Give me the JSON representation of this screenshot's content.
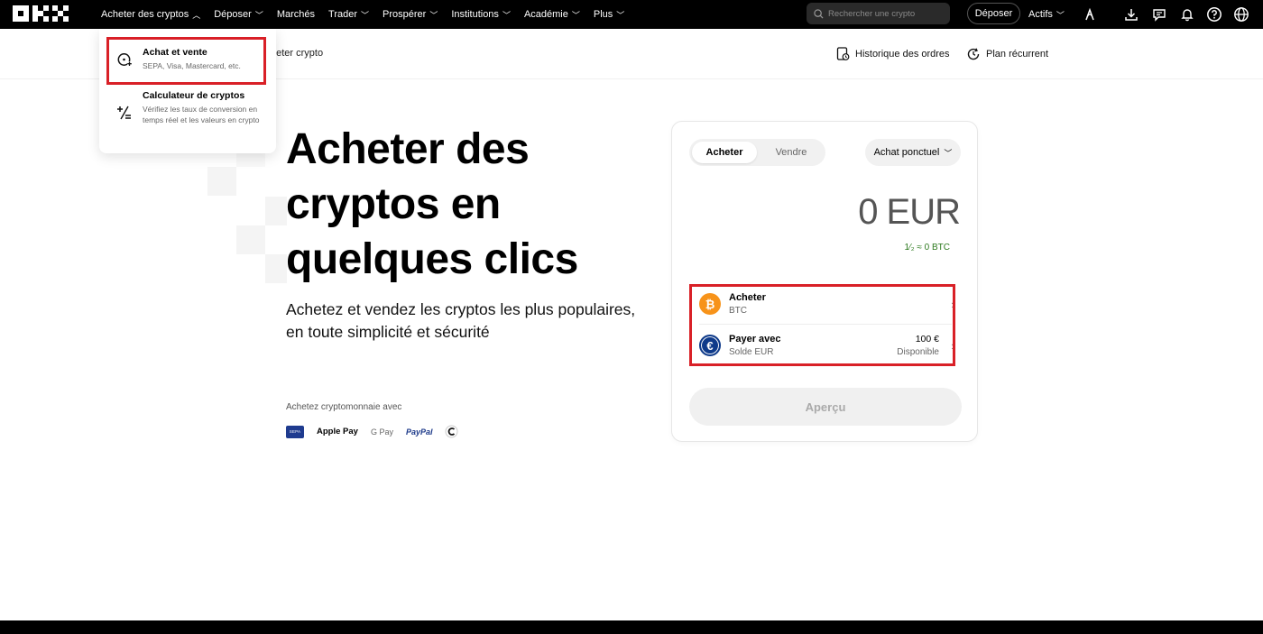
{
  "topnav": {
    "items": [
      {
        "label": "Acheter des cryptos",
        "chevron": "up"
      },
      {
        "label": "Déposer",
        "chevron": "down"
      },
      {
        "label": "Marchés",
        "chevron": ""
      },
      {
        "label": "Trader",
        "chevron": "down"
      },
      {
        "label": "Prospérer",
        "chevron": "down"
      },
      {
        "label": "Institutions",
        "chevron": "down"
      },
      {
        "label": "Académie",
        "chevron": "down"
      },
      {
        "label": "Plus",
        "chevron": "down"
      }
    ],
    "search_placeholder": "Rechercher une crypto",
    "deposit_label": "Déposer",
    "assets_label": "Actifs",
    "icons": [
      "user-icon",
      "download-icon",
      "chat-icon",
      "bell-icon",
      "help-icon",
      "globe-icon"
    ]
  },
  "dropdown": {
    "items": [
      {
        "title": "Achat et vente",
        "subtitle": "SEPA, Visa, Mastercard, etc.",
        "icon": "buy-sell-icon"
      },
      {
        "title": "Calculateur de cryptos",
        "subtitle": "Vérifiez les taux de conversion en temps réel et les valeurs en crypto",
        "icon": "calculator-icon"
      }
    ]
  },
  "subnav": {
    "crumb": "heter crypto",
    "order_history": "Historique des ordres",
    "recurring_plan": "Plan récurrent"
  },
  "hero": {
    "title_lines": [
      "Acheter des",
      "cryptos en",
      "quelques clics"
    ],
    "subtitle_lines": [
      "Achetez et vendez les cryptos les plus populaires,",
      "en toute simplicité et sécurité"
    ],
    "pay_label": "Achetez cryptomonnaie avec",
    "pay_methods": [
      "SEPA",
      "Apple Pay",
      "G Pay",
      "PayPal",
      "Revolut"
    ]
  },
  "card": {
    "tab_buy": "Acheter",
    "tab_sell": "Vendre",
    "mode": "Achat ponctuel",
    "amount": "0 EUR",
    "rate": "1⁄₂ ≈ 0 BTC",
    "buy_row": {
      "title": "Acheter",
      "subtitle": "BTC"
    },
    "pay_row": {
      "title": "Payer avec",
      "subtitle": "Solde EUR",
      "value": "100 €",
      "value_sub": "Disponible"
    },
    "preview_label": "Aperçu"
  },
  "colors": {
    "accent": "#000000",
    "highlight": "#d92027",
    "btc": "#f7931a",
    "eur": "#0e3a8a",
    "rate": "#2d7a1f"
  }
}
